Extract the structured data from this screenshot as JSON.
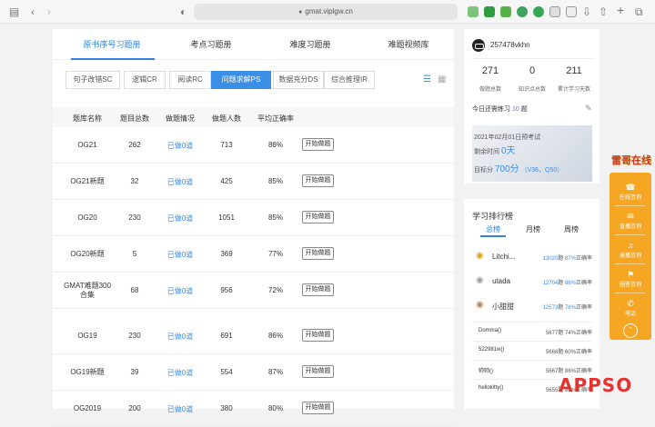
{
  "browser": {
    "url": "gmat.viplgw.cn"
  },
  "main_tabs": [
    "原书序号习题册",
    "考点习题册",
    "难度习题册",
    "难题视频库"
  ],
  "sub_tabs": [
    "句子改错SC",
    "逻辑CR",
    "阅读RC",
    "问题求解PS",
    "数据充分DS",
    "综合推理IR"
  ],
  "table": {
    "headers": [
      "题库名称",
      "题目总数",
      "做题情况",
      "做题人数",
      "平均正确率"
    ],
    "rows": [
      {
        "name": "OG21",
        "total": "262",
        "status": "已做0道",
        "people": "713",
        "rate": "86%",
        "action": "开始做题"
      },
      {
        "name": "OG21新题",
        "total": "32",
        "status": "已做0道",
        "people": "425",
        "rate": "85%",
        "action": "开始做题"
      },
      {
        "name": "OG20",
        "total": "230",
        "status": "已做0道",
        "people": "1051",
        "rate": "85%",
        "action": "开始做题"
      },
      {
        "name": "OG20新题",
        "total": "5",
        "status": "已做0道",
        "people": "369",
        "rate": "77%",
        "action": "开始做题"
      },
      {
        "name": "GMAT难题300",
        "name2": "合集",
        "total": "68",
        "status": "已做0道",
        "people": "956",
        "rate": "72%",
        "action": "开始做题"
      },
      {
        "name": "OG19",
        "total": "230",
        "status": "已做0道",
        "people": "691",
        "rate": "86%",
        "action": "开始做题"
      },
      {
        "name": "OG19新题",
        "total": "39",
        "status": "已做0道",
        "people": "554",
        "rate": "87%",
        "action": "开始做题"
      },
      {
        "name": "OG2019",
        "total": "200",
        "status": "已做0道",
        "people": "380",
        "rate": "80%",
        "action": "开始做题"
      }
    ]
  },
  "profile": {
    "username": "257478vkhn",
    "stats": [
      {
        "value": "271",
        "label": "做题总数"
      },
      {
        "value": "0",
        "label": "知识点总数"
      },
      {
        "value": "211",
        "label": "累计学习天数"
      }
    ],
    "today_prefix": "今日还需练习",
    "today_count": "10",
    "today_suffix": "题",
    "exam_date": "2021年02月01日预考试",
    "remaining_prefix": "剩余时间",
    "remaining_value": "0天",
    "target_prefix": "目标分",
    "target_value": "700分",
    "target_detail": "（V36，Q50）"
  },
  "ranking": {
    "title": "学习排行榜",
    "tabs": [
      "总榜",
      "月榜",
      "周榜"
    ],
    "top": [
      {
        "name": "Litchi...",
        "count": "13020",
        "unit": "题",
        "rate": "87%",
        "rate_label": "正确率"
      },
      {
        "name": "utada",
        "count": "12704",
        "unit": "题",
        "rate": "88%",
        "rate_label": "正确率"
      },
      {
        "name": "小甜甜",
        "count": "12573",
        "unit": "题",
        "rate": "78%",
        "rate_label": "正确率"
      }
    ],
    "list": [
      {
        "name": "Domma()",
        "stat": "5677题 74%正确率"
      },
      {
        "name": "522981w()",
        "stat": "5668题 60%正确率"
      },
      {
        "name": "帅帅()",
        "stat": "5667题 86%正确率"
      },
      {
        "name": "hellokitty()",
        "stat": "5655题 81%正确率"
      }
    ]
  },
  "float_bar": {
    "mascot_text": "雷哥在线",
    "items": [
      "在线咨询",
      "直播咨询",
      "录播咨询",
      "圈答咨询",
      "电话"
    ]
  },
  "watermark": "APPSO",
  "colors": {
    "accent": "#2e84d8",
    "float": "#f5a623",
    "watermark": "#e8322f"
  }
}
